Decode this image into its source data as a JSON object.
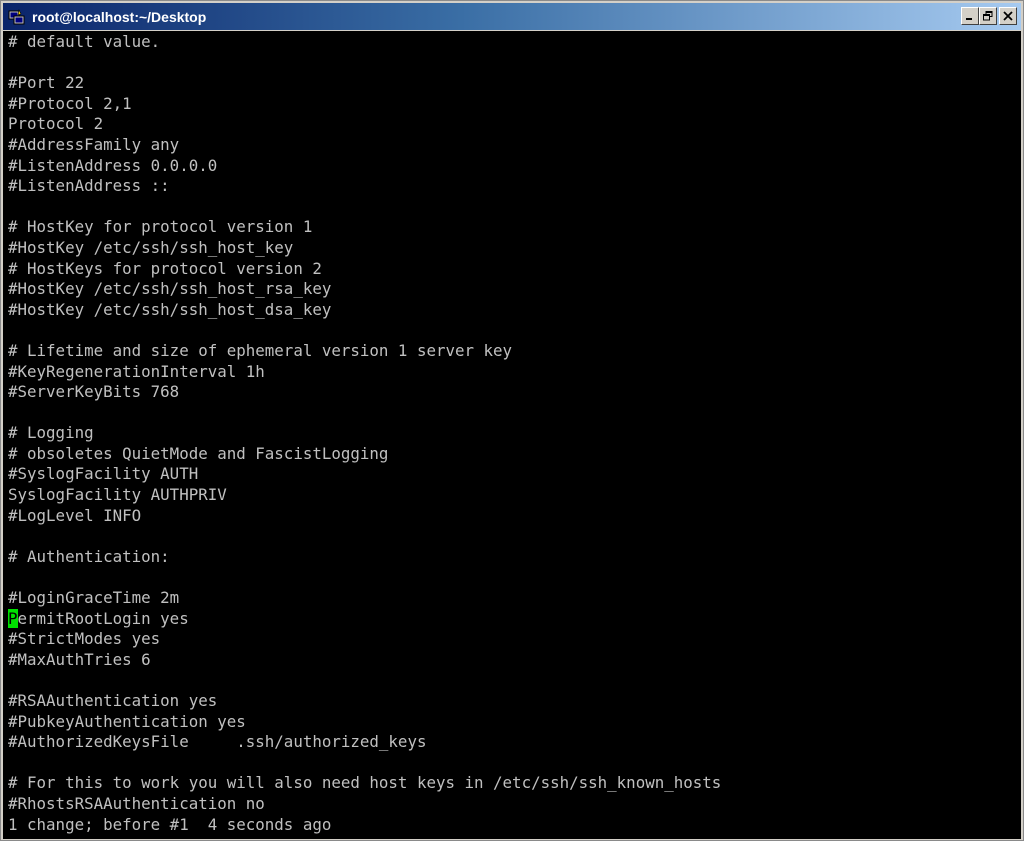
{
  "window": {
    "title": "root@localhost:~/Desktop",
    "icon": "putty-terminal-icon",
    "buttons": {
      "minimize_icon": "minimize-icon",
      "restore_icon": "restore-icon",
      "close_icon": "close-icon"
    }
  },
  "colors": {
    "terminal_bg": "#000000",
    "terminal_fg": "#c0c0c0",
    "cursor": "#00e000",
    "titlebar_start": "#0a246a",
    "titlebar_end": "#a6caf0"
  },
  "terminal": {
    "cursor": {
      "line_index": 28,
      "char": "P",
      "rest": "ermitRootLogin yes"
    },
    "lines": [
      "# default value.",
      "",
      "#Port 22",
      "#Protocol 2,1",
      "Protocol 2",
      "#AddressFamily any",
      "#ListenAddress 0.0.0.0",
      "#ListenAddress ::",
      "",
      "# HostKey for protocol version 1",
      "#HostKey /etc/ssh/ssh_host_key",
      "# HostKeys for protocol version 2",
      "#HostKey /etc/ssh/ssh_host_rsa_key",
      "#HostKey /etc/ssh/ssh_host_dsa_key",
      "",
      "# Lifetime and size of ephemeral version 1 server key",
      "#KeyRegenerationInterval 1h",
      "#ServerKeyBits 768",
      "",
      "# Logging",
      "# obsoletes QuietMode and FascistLogging",
      "#SyslogFacility AUTH",
      "SyslogFacility AUTHPRIV",
      "#LogLevel INFO",
      "",
      "# Authentication:",
      "",
      "#LoginGraceTime 2m",
      "PermitRootLogin yes",
      "#StrictModes yes",
      "#MaxAuthTries 6",
      "",
      "#RSAAuthentication yes",
      "#PubkeyAuthentication yes",
      "#AuthorizedKeysFile     .ssh/authorized_keys",
      "",
      "# For this to work you will also need host keys in /etc/ssh/ssh_known_hosts",
      "#RhostsRSAAuthentication no",
      "1 change; before #1  4 seconds ago"
    ]
  }
}
